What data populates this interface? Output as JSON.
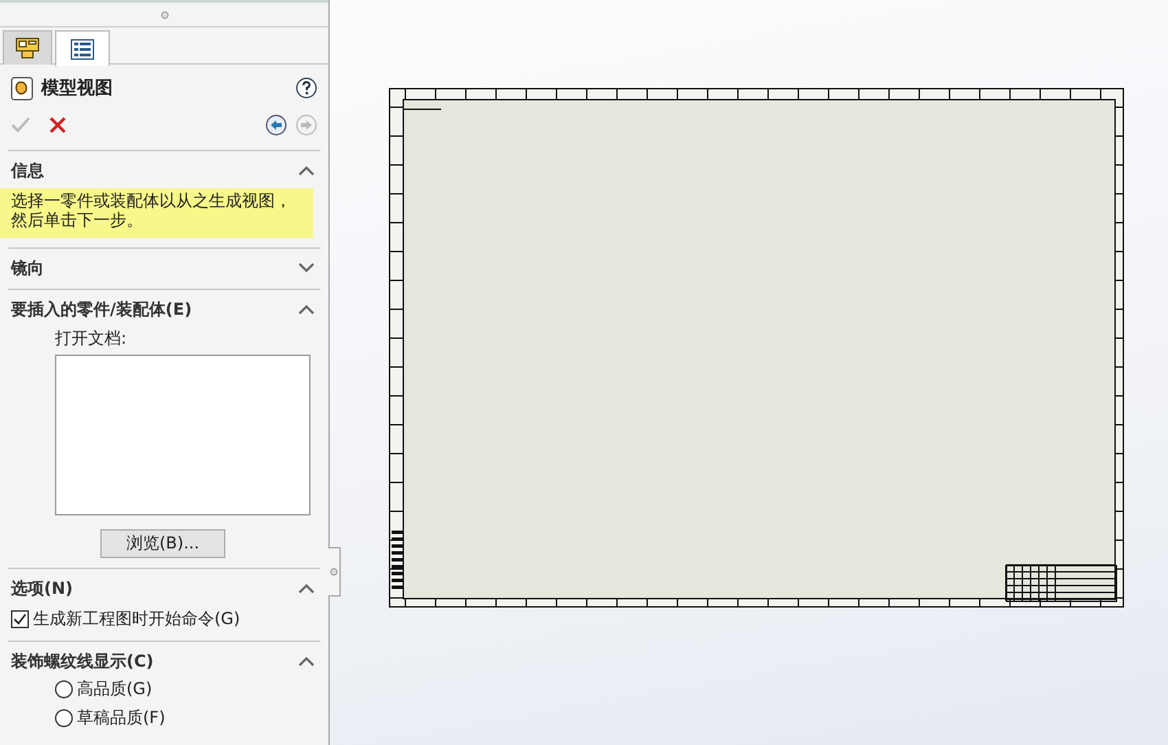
{
  "panel_tabs": [
    {
      "kind": "feature-manager",
      "selected": false
    },
    {
      "kind": "property-manager",
      "selected": true
    }
  ],
  "header": {
    "title": "模型视图"
  },
  "actions": [
    {
      "kind": "ok",
      "disabled": true
    },
    {
      "kind": "cancel",
      "disabled": false
    },
    {
      "kind": "back",
      "disabled": false
    },
    {
      "kind": "forward",
      "disabled": true
    }
  ],
  "sections": [
    {
      "kind": "message",
      "title": "信息",
      "expanded": true,
      "message": "选择一零件或装配体以从之生成视图，然后单击下一步。"
    },
    {
      "title": "镜向",
      "expanded": false
    },
    {
      "kind": "documents",
      "title": "要插入的零件/装配体(E)",
      "expanded": true,
      "label": "打开文档:",
      "button": "浏览(B)..."
    },
    {
      "kind": "checkboxes",
      "title": "选项(N)",
      "expanded": true,
      "items": [
        {
          "label": "生成新工程图时开始命令(G)",
          "checked": true
        }
      ]
    },
    {
      "kind": "radios",
      "title": "装饰螺纹线显示(C)",
      "expanded": true,
      "items": [
        {
          "label": "高品质(G)",
          "selected": false
        },
        {
          "label": "草稿品质(F)",
          "selected": false
        }
      ]
    }
  ]
}
